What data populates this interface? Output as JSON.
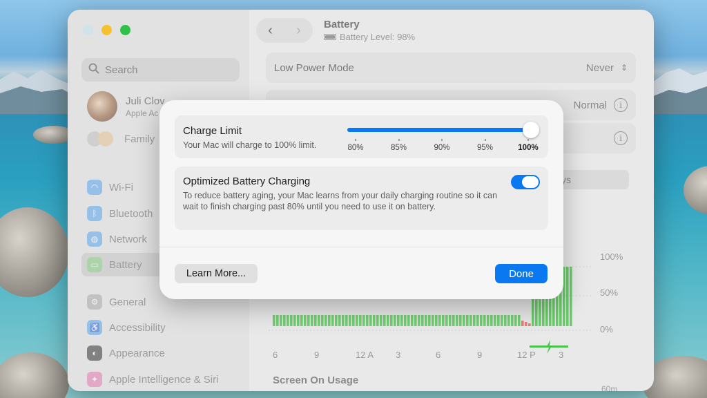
{
  "window": {
    "title": "Battery",
    "subtitle": "Battery Level: 98%",
    "battery_level": 0.98
  },
  "sidebar": {
    "search_placeholder": "Search",
    "profile": {
      "name": "Juli Clov",
      "subtitle": "Apple Ac"
    },
    "family_label": "Family",
    "items": [
      {
        "label": "Wi-Fi",
        "icon": "wifi-icon",
        "color": "#5aa6f0"
      },
      {
        "label": "Bluetooth",
        "icon": "bluetooth-icon",
        "color": "#5aa6f0"
      },
      {
        "label": "Network",
        "icon": "globe-icon",
        "color": "#5aa6f0"
      },
      {
        "label": "Battery",
        "icon": "battery-icon",
        "color": "#8fd48a",
        "active": true
      },
      {
        "label": "General",
        "icon": "gear-icon",
        "color": "#a8a8a8"
      },
      {
        "label": "Accessibility",
        "icon": "accessibility-icon",
        "color": "#5aa6f0"
      },
      {
        "label": "Appearance",
        "icon": "appearance-icon",
        "color": "#333333"
      },
      {
        "label": "Apple Intelligence & Siri",
        "icon": "siri-icon",
        "color": "#e57ab0"
      }
    ]
  },
  "main": {
    "low_power": {
      "label": "Low Power Mode",
      "value": "Never"
    },
    "battery_health": {
      "value": "Normal"
    },
    "segment_fragment": "ys",
    "chart": {
      "y_labels": [
        "100%",
        "50%",
        "0%"
      ],
      "x_labels": [
        "6",
        "9",
        "12 A",
        "3",
        "6",
        "9",
        "12 P",
        "3"
      ]
    },
    "screen_on_usage": "Screen On Usage",
    "sixty_label": "60m"
  },
  "dialog": {
    "charge_limit": {
      "title": "Charge Limit",
      "description": "Your Mac will charge to 100% limit.",
      "ticks": [
        "80%",
        "85%",
        "90%",
        "95%",
        "100%"
      ],
      "value_fraction": 1.0
    },
    "optimized": {
      "title": "Optimized Battery Charging",
      "description": "To reduce battery aging, your Mac learns from your daily charging routine so it can wait to finish charging past 80% until you need to use it on battery.",
      "enabled": true
    },
    "learn_more": "Learn More...",
    "done": "Done"
  },
  "colors": {
    "accent": "#0a78f0",
    "chart_green": "#4cc34c",
    "chart_red": "#e45a5a"
  }
}
